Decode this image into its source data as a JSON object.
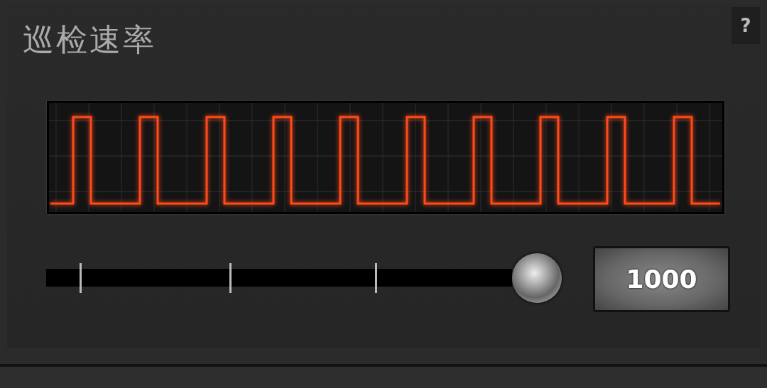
{
  "title": "巡检速率",
  "help_button": "?",
  "slider": {
    "level": 1
  },
  "value": "1000"
}
